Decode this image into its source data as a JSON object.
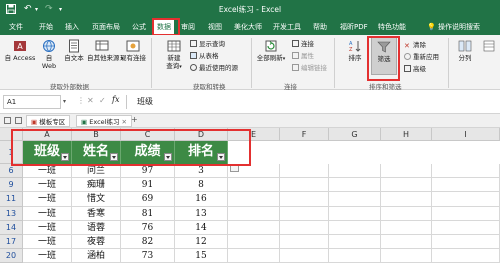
{
  "titlebar": {
    "title": "Excel练习 - Excel",
    "save_icon": "save-icon",
    "undo_icon": "undo-icon",
    "redo_icon": "redo-icon"
  },
  "menu": {
    "tabs": [
      "文件",
      "开始",
      "插入",
      "页面布局",
      "公式",
      "数据",
      "审阅",
      "视图",
      "美化大师",
      "开发工具",
      "帮助",
      "福昕PDF",
      "特色功能"
    ],
    "active_tab": "数据",
    "tell_me": "操作说明搜索",
    "tell_me_icon": "lightbulb-icon"
  },
  "ribbon": {
    "get_external": {
      "label": "获取外部数据",
      "access": "自 Access",
      "web_line1": "自",
      "web_line2": "Web",
      "text": "自文本",
      "other_line1": "自其他来源",
      "other_line2": "",
      "existing": "现有连接"
    },
    "transform": {
      "label": "获取和转换",
      "new_query_line1": "新建",
      "new_query_line2": "查询",
      "show_queries": "显示查询",
      "from_table": "从表格",
      "recent_sources": "最近使用的源"
    },
    "connections": {
      "label": "连接",
      "refresh_all": "全部刷新",
      "connections": "连接",
      "properties": "属性",
      "edit_links": "编辑链接"
    },
    "sort_filter": {
      "label": "排序和筛选",
      "sort": "排序",
      "filter": "筛选",
      "clear": "清除",
      "reapply": "重新应用",
      "advanced": "高级"
    },
    "tools": {
      "split": "分列"
    }
  },
  "formulabar": {
    "name_box": "A1",
    "fx": "fx",
    "content": "班级"
  },
  "sheettabs": {
    "template_tab": "模板专区",
    "file_tab": "Excel练习"
  },
  "grid": {
    "columns": [
      "A",
      "B",
      "C",
      "D",
      "E",
      "F",
      "G",
      "H",
      "I"
    ],
    "header_row_num": "1",
    "headers": [
      "班级",
      "姓名",
      "成绩",
      "排名"
    ],
    "rows": [
      {
        "num": "6",
        "cells": [
          "一班",
          "问兰",
          "97",
          "3"
        ]
      },
      {
        "num": "9",
        "cells": [
          "一班",
          "痴珊",
          "91",
          "8"
        ]
      },
      {
        "num": "11",
        "cells": [
          "一班",
          "惜文",
          "69",
          "16"
        ]
      },
      {
        "num": "13",
        "cells": [
          "一班",
          "香寒",
          "81",
          "13"
        ]
      },
      {
        "num": "14",
        "cells": [
          "一班",
          "语蓉",
          "76",
          "14"
        ]
      },
      {
        "num": "17",
        "cells": [
          "一班",
          "夜蓉",
          "82",
          "12"
        ]
      },
      {
        "num": "20",
        "cells": [
          "一班",
          "涵柏",
          "73",
          "15"
        ]
      }
    ]
  },
  "colors": {
    "excel_green": "#217346",
    "header_green": "#3d8a45",
    "highlight_red": "#e33030"
  }
}
